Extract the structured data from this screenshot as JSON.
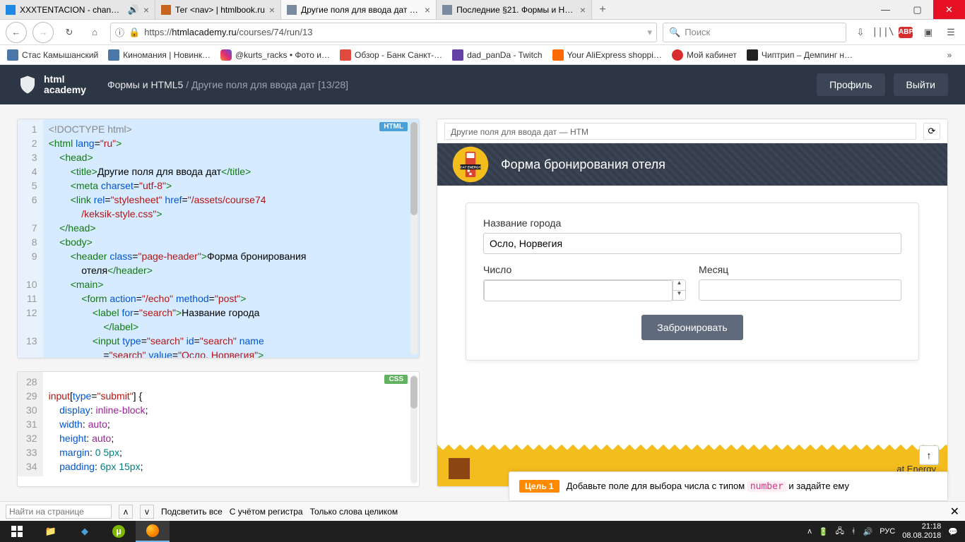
{
  "tabs": [
    {
      "title": "XXXTENTACION - changes",
      "icon": "#1e88e5"
    },
    {
      "title": "Тег <nav> | htmlbook.ru",
      "icon": "#c8641e"
    },
    {
      "title": "Другие поля для ввода дат — …",
      "icon": "#7a8aa0",
      "active": true
    },
    {
      "title": "Последние §21. Формы и HTM…",
      "icon": "#7a8aa0"
    }
  ],
  "url": {
    "scheme": "https://",
    "domain": "htmlacademy.ru",
    "path": "/courses/74/run/13",
    "placeholder": "Поиск"
  },
  "bookmarks": [
    {
      "label": "Стас Камышанский",
      "color": "#4a76a8"
    },
    {
      "label": "Киномания | Новинк…",
      "color": "#4a76a8"
    },
    {
      "label": "@kurts_racks • Фото и…",
      "color": "#d63384"
    },
    {
      "label": "Обзор - Банк Санкт-…",
      "color": "#e04a3f"
    },
    {
      "label": "dad_panDa - Twitch",
      "color": "#6441a5"
    },
    {
      "label": "Your AliExpress shoppi…",
      "color": "#ff6a00"
    },
    {
      "label": "Мой кабинет",
      "color": "#d92d2d"
    },
    {
      "label": "Чиптрип – Демпинг н…",
      "color": "#222"
    }
  ],
  "header": {
    "logo1": "html",
    "logo2": "academy",
    "bc1": "Формы и HTML5",
    "bc2": "Другие поля для ввода дат",
    "bc3": "[13/28]",
    "profile": "Профиль",
    "logout": "Выйти"
  },
  "htmlBadge": "HTML",
  "cssBadge": "CSS",
  "htmlLines": [
    "1",
    "2",
    "3",
    "4",
    "5",
    "6",
    "",
    "7",
    "8",
    "9",
    "",
    "10",
    "11",
    "12",
    "",
    "13",
    ""
  ],
  "cssLines": [
    "28",
    "29",
    "30",
    "31",
    "32",
    "33",
    "34"
  ],
  "preview": {
    "tabtitle": "Другие поля для ввода дат — HTM",
    "heading": "Форма бронирования отеля",
    "cityLabel": "Название города",
    "cityValue": "Осло, Норвегия",
    "numLabel": "Число",
    "monthLabel": "Месяц",
    "submit": "Забронировать",
    "footerBrand": "at Energy"
  },
  "task": {
    "goal": "Цель 1",
    "t1": "Добавьте поле для выбора числа с типом ",
    "kw": "number",
    "t2": " и задайте ему"
  },
  "findbar": {
    "placeholder": "Найти на странице",
    "highlight": "Подсветить все",
    "case": "С учётом регистра",
    "whole": "Только слова целиком"
  },
  "systray": {
    "lang": "РУС",
    "time": "21:18",
    "date": "08.08.2018"
  }
}
